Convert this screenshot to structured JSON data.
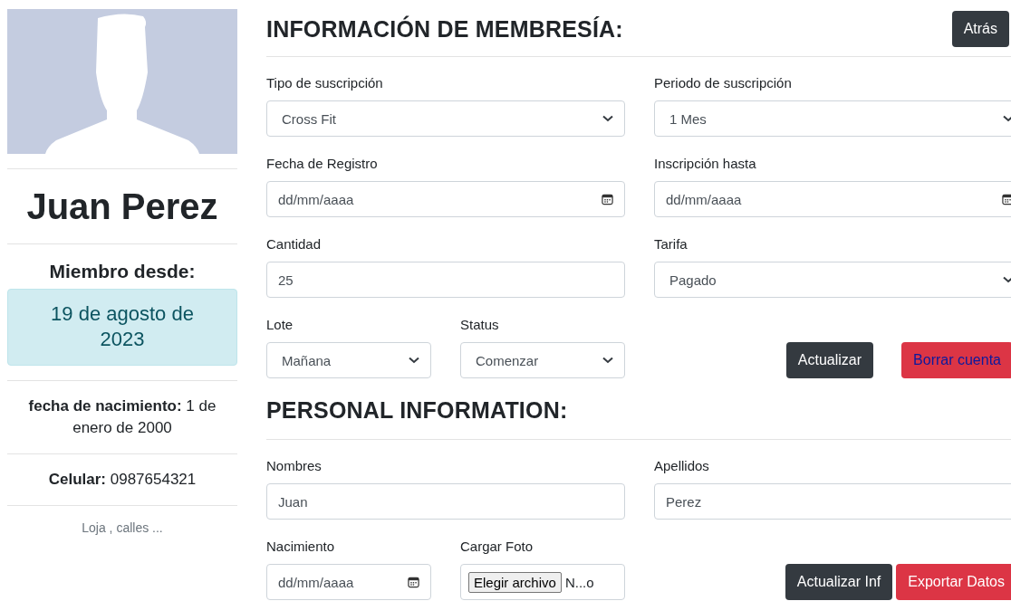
{
  "profile": {
    "name": "Juan Perez",
    "member_since_label": "Miembro desde:",
    "member_since": "19 de agosto de 2023",
    "birth": "**fecha de nacimiento:** 1 de enero de 2000",
    "phone": "**Celular:** 0987654321",
    "address": "Loja , calles ..."
  },
  "membership": {
    "title": "INFORMACIÓN DE MEMBRESÍA:",
    "back_button": "Atrás",
    "fields": [
      {
        "label": "Tipo de suscripción",
        "kind": "select",
        "value": "Cross Fit"
      },
      {
        "label": "Periodo de suscripción",
        "kind": "select",
        "value": "1 Mes"
      },
      {
        "label": "Fecha de Registro",
        "kind": "date",
        "placeholder": "dd/mm/aaaa"
      },
      {
        "label": "Inscripción hasta",
        "kind": "date",
        "placeholder": "dd/mm/aaaa"
      },
      {
        "label": "Cantidad",
        "kind": "text",
        "value": "25"
      },
      {
        "label": "Tarifa",
        "kind": "select",
        "value": "Pagado"
      },
      {
        "label": "Lote",
        "kind": "select",
        "value": "Mañana"
      },
      {
        "label": "Status",
        "kind": "select",
        "value": "Comenzar"
      }
    ],
    "buttons": [
      {
        "label": "Actualizar",
        "kind": "dark"
      },
      {
        "label": "Borrar cuenta",
        "kind": "danger-link"
      }
    ]
  },
  "personal": {
    "title": "PERSONAL INFORMATION:",
    "fields": [
      {
        "label": "Nombres",
        "kind": "text",
        "value": "Juan"
      },
      {
        "label": "Apellidos",
        "kind": "text",
        "value": "Perez"
      },
      {
        "label": "Nacimiento",
        "kind": "date",
        "placeholder": "dd/mm/aaaa"
      },
      {
        "label": "Cargar Foto",
        "kind": "file",
        "button_label": "Elegir archivo",
        "value": "N...o"
      }
    ],
    "buttons": [
      {
        "label": "Actualizar Inf",
        "kind": "dark"
      },
      {
        "label": "Exportar Datos",
        "kind": "danger"
      }
    ]
  }
}
